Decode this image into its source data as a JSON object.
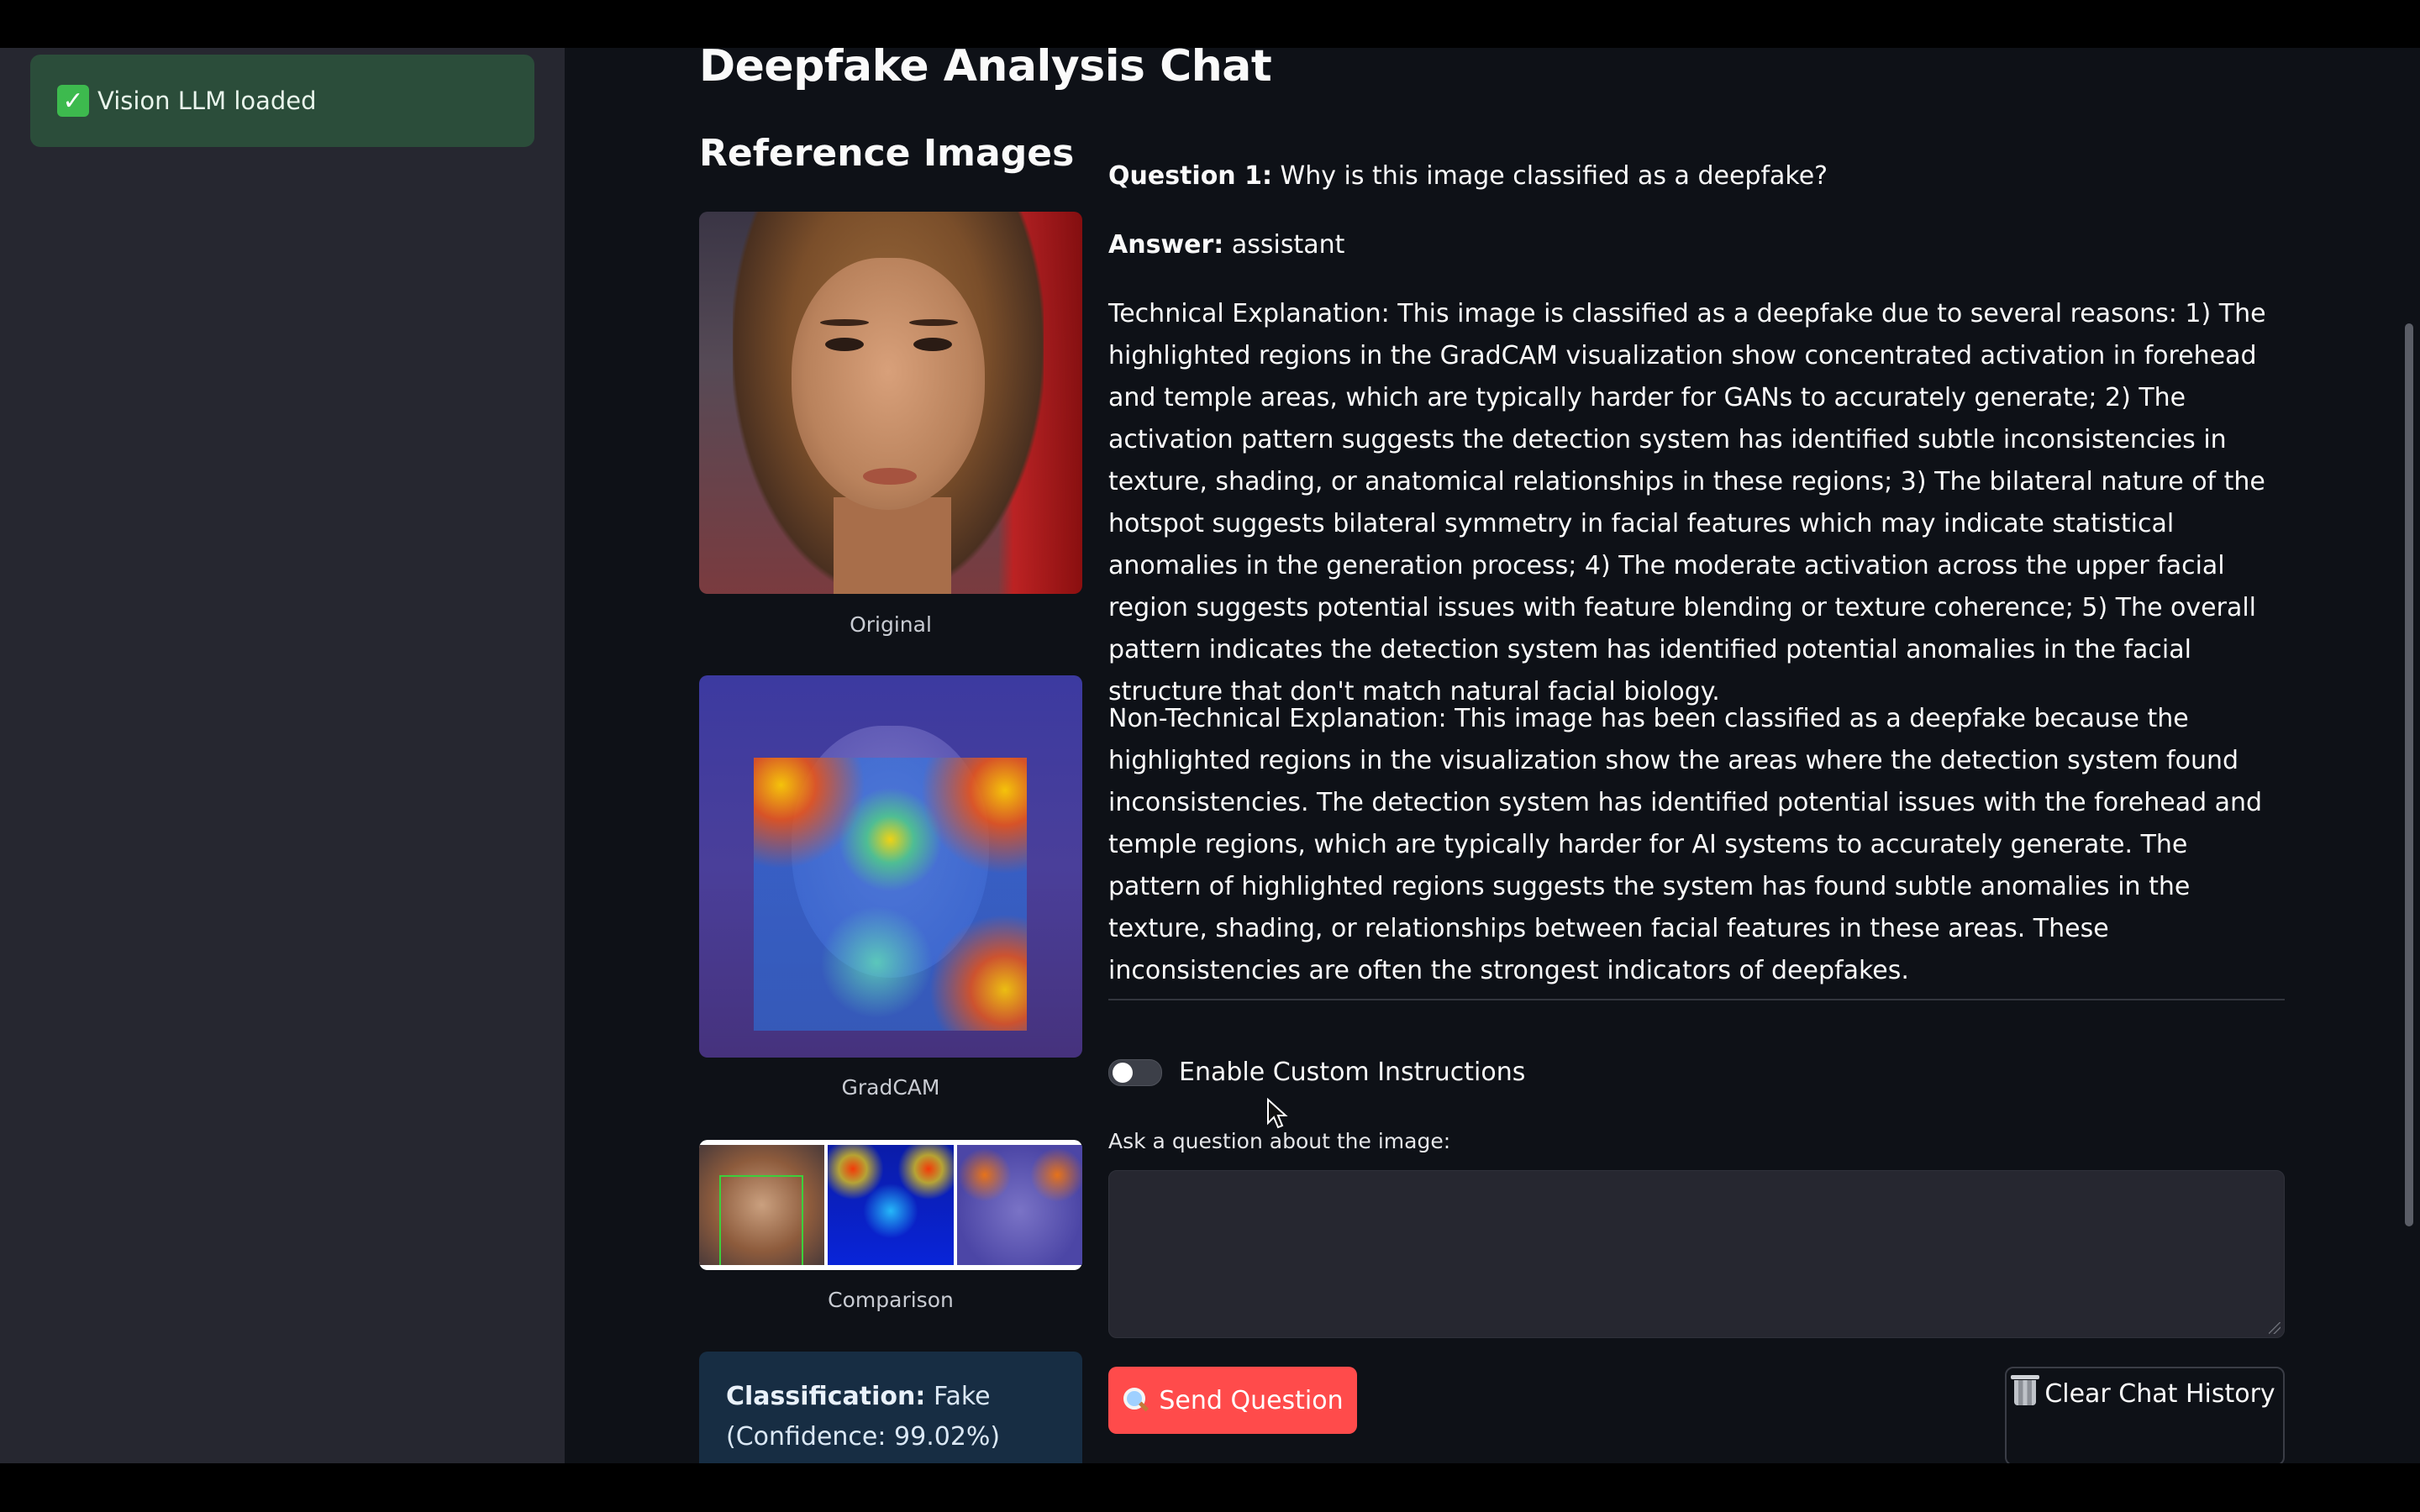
{
  "sidebar": {
    "alert": {
      "text": "Vision LLM loaded",
      "icon": "check-icon",
      "color": "#2b4d3a"
    }
  },
  "main": {
    "title": "Deepfake Analysis Chat",
    "reference_title": "Reference Images",
    "images": {
      "original_caption": "Original",
      "gradcam_caption": "GradCAM",
      "comparison_caption": "Comparison"
    },
    "classification": {
      "label": "Classification:",
      "value": "Fake",
      "confidence": "(Confidence: 99.02%)"
    },
    "chat": {
      "question_label": "Question 1:",
      "question_text": "Why is this image classified as a deepfake?",
      "answer_label": "Answer:",
      "answer_text": "assistant",
      "technical": "Technical Explanation: This image is classified as a deepfake due to several reasons: 1) The highlighted regions in the GradCAM visualization show concentrated activation in forehead and temple areas, which are typically harder for GANs to accurately generate; 2) The activation pattern suggests the detection system has identified subtle inconsistencies in texture, shading, or anatomical relationships in these regions; 3) The bilateral nature of the hotspot suggests bilateral symmetry in facial features which may indicate statistical anomalies in the generation process; 4) The moderate activation across the upper facial region suggests potential issues with feature blending or texture coherence; 5) The overall pattern indicates the detection system has identified potential anomalies in the facial structure that don't match natural facial biology.",
      "non_technical": "Non-Technical Explanation: This image has been classified as a deepfake because the highlighted regions in the visualization show the areas where the detection system found inconsistencies. The detection system has identified potential issues with the forehead and temple regions, which are typically harder for AI systems to accurately generate. The pattern of highlighted regions suggests the system has found subtle anomalies in the texture, shading, or relationships between facial features in these areas. These inconsistencies are often the strongest indicators of deepfakes."
    },
    "toggle": {
      "label": "Enable Custom Instructions",
      "enabled": false
    },
    "input": {
      "label": "Ask a question about the image:",
      "value": ""
    },
    "send_button": {
      "label": "Send Question",
      "icon": "magnifier-icon",
      "color": "#ff4b4b"
    },
    "clear_button": {
      "label": "Clear Chat History",
      "icon": "trash-icon"
    }
  }
}
